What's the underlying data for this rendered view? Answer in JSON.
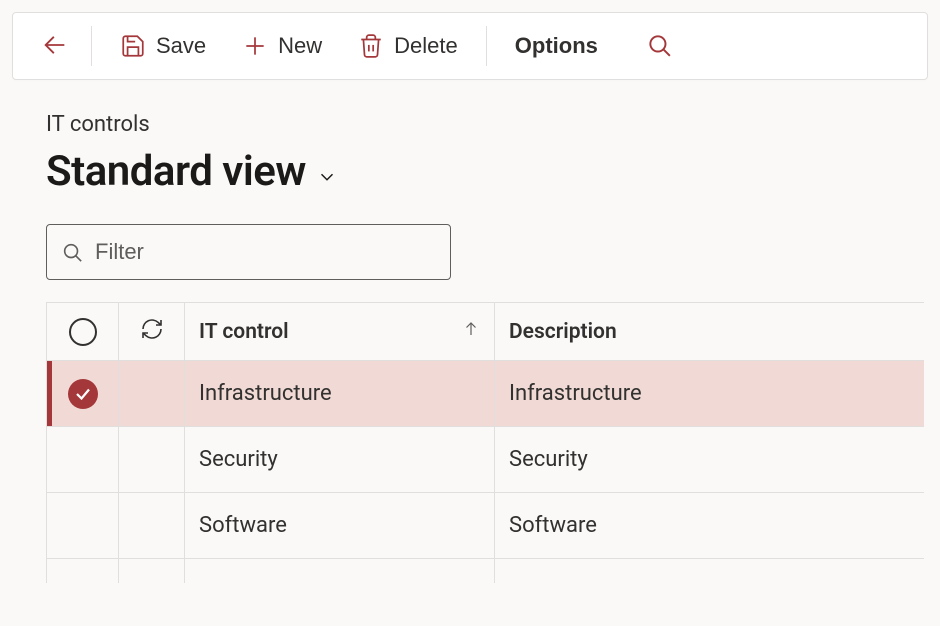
{
  "toolbar": {
    "save_label": "Save",
    "new_label": "New",
    "delete_label": "Delete",
    "options_label": "Options"
  },
  "page": {
    "breadcrumb": "IT controls",
    "view_title": "Standard view"
  },
  "filter": {
    "placeholder": "Filter"
  },
  "grid": {
    "columns": {
      "it_control": "IT control",
      "description": "Description"
    },
    "rows": [
      {
        "it_control": "Infrastructure",
        "description": "Infrastructure",
        "selected": true
      },
      {
        "it_control": "Security",
        "description": "Security",
        "selected": false
      },
      {
        "it_control": "Software",
        "description": "Software",
        "selected": false
      }
    ]
  }
}
